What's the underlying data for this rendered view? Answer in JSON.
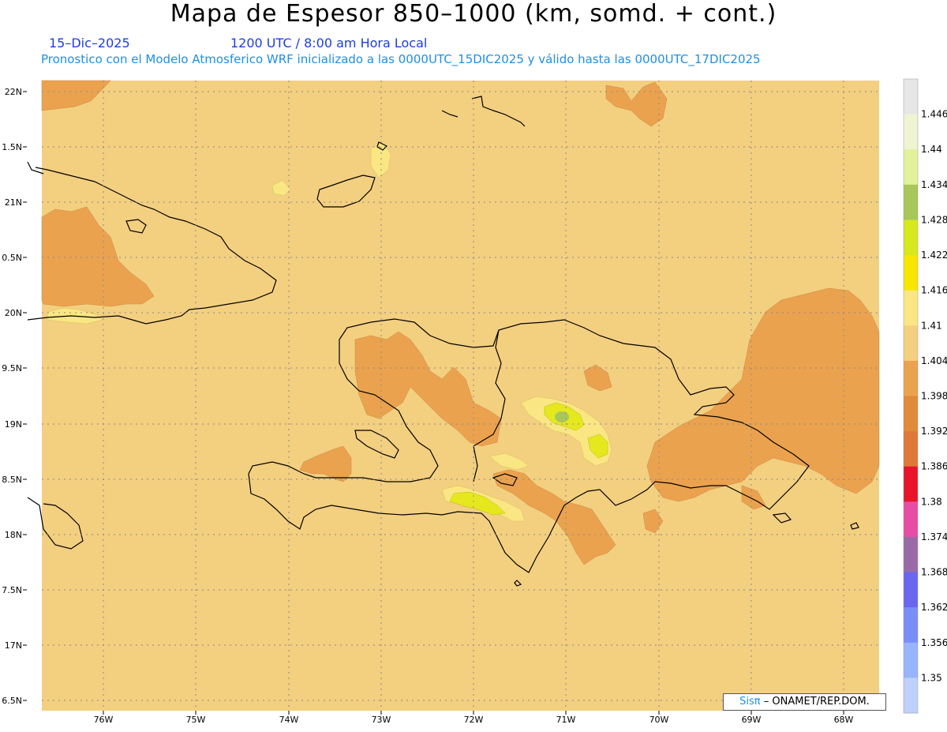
{
  "header": {
    "title": "Mapa de Espesor 850–1000 (km, somd. + cont.)",
    "date": "15–Dic–2025",
    "time": "1200 UTC / 8:00 am Hora Local",
    "model_info": "Pronostico con el Modelo Atmosferico WRF inicializado a las 0000UTC_15DIC2025 y válido hasta las  0000UTC_17DIC2025"
  },
  "axes": {
    "lat_labels": [
      "22N",
      "1.5N",
      "21N",
      "0.5N",
      "20N",
      "9.5N",
      "19N",
      "8.5N",
      "18N",
      "7.5N",
      "17N",
      "6.5N"
    ],
    "lon_labels": [
      "76W",
      "75W",
      "74W",
      "73W",
      "72W",
      "71W",
      "70W",
      "69W",
      "68W"
    ]
  },
  "colorbar": {
    "labels": [
      "1.446",
      "1.44",
      "1.434",
      "1.428",
      "1.422",
      "1.416",
      "1.41",
      "1.404",
      "1.398",
      "1.392",
      "1.386",
      "1.38",
      "1.374",
      "1.368",
      "1.362",
      "1.356",
      "1.35"
    ],
    "colors": [
      "#e6e6e6",
      "#f0f4d2",
      "#e2f29a",
      "#a8c65a",
      "#d6e81e",
      "#f6e600",
      "#fae682",
      "#f2d080",
      "#eba24e",
      "#e08a3a",
      "#df7838",
      "#e8142c",
      "#e64ea6",
      "#9a6aa8",
      "#6a66f0",
      "#7a8ef8",
      "#98b4fc",
      "#c0d0fc"
    ]
  },
  "map": {
    "background_color": "#f3cf80",
    "dominant_value_range": "1.404–1.41"
  },
  "credit": {
    "brand": "Sisπ",
    "text": "– ONAMET/REP.DOM."
  }
}
